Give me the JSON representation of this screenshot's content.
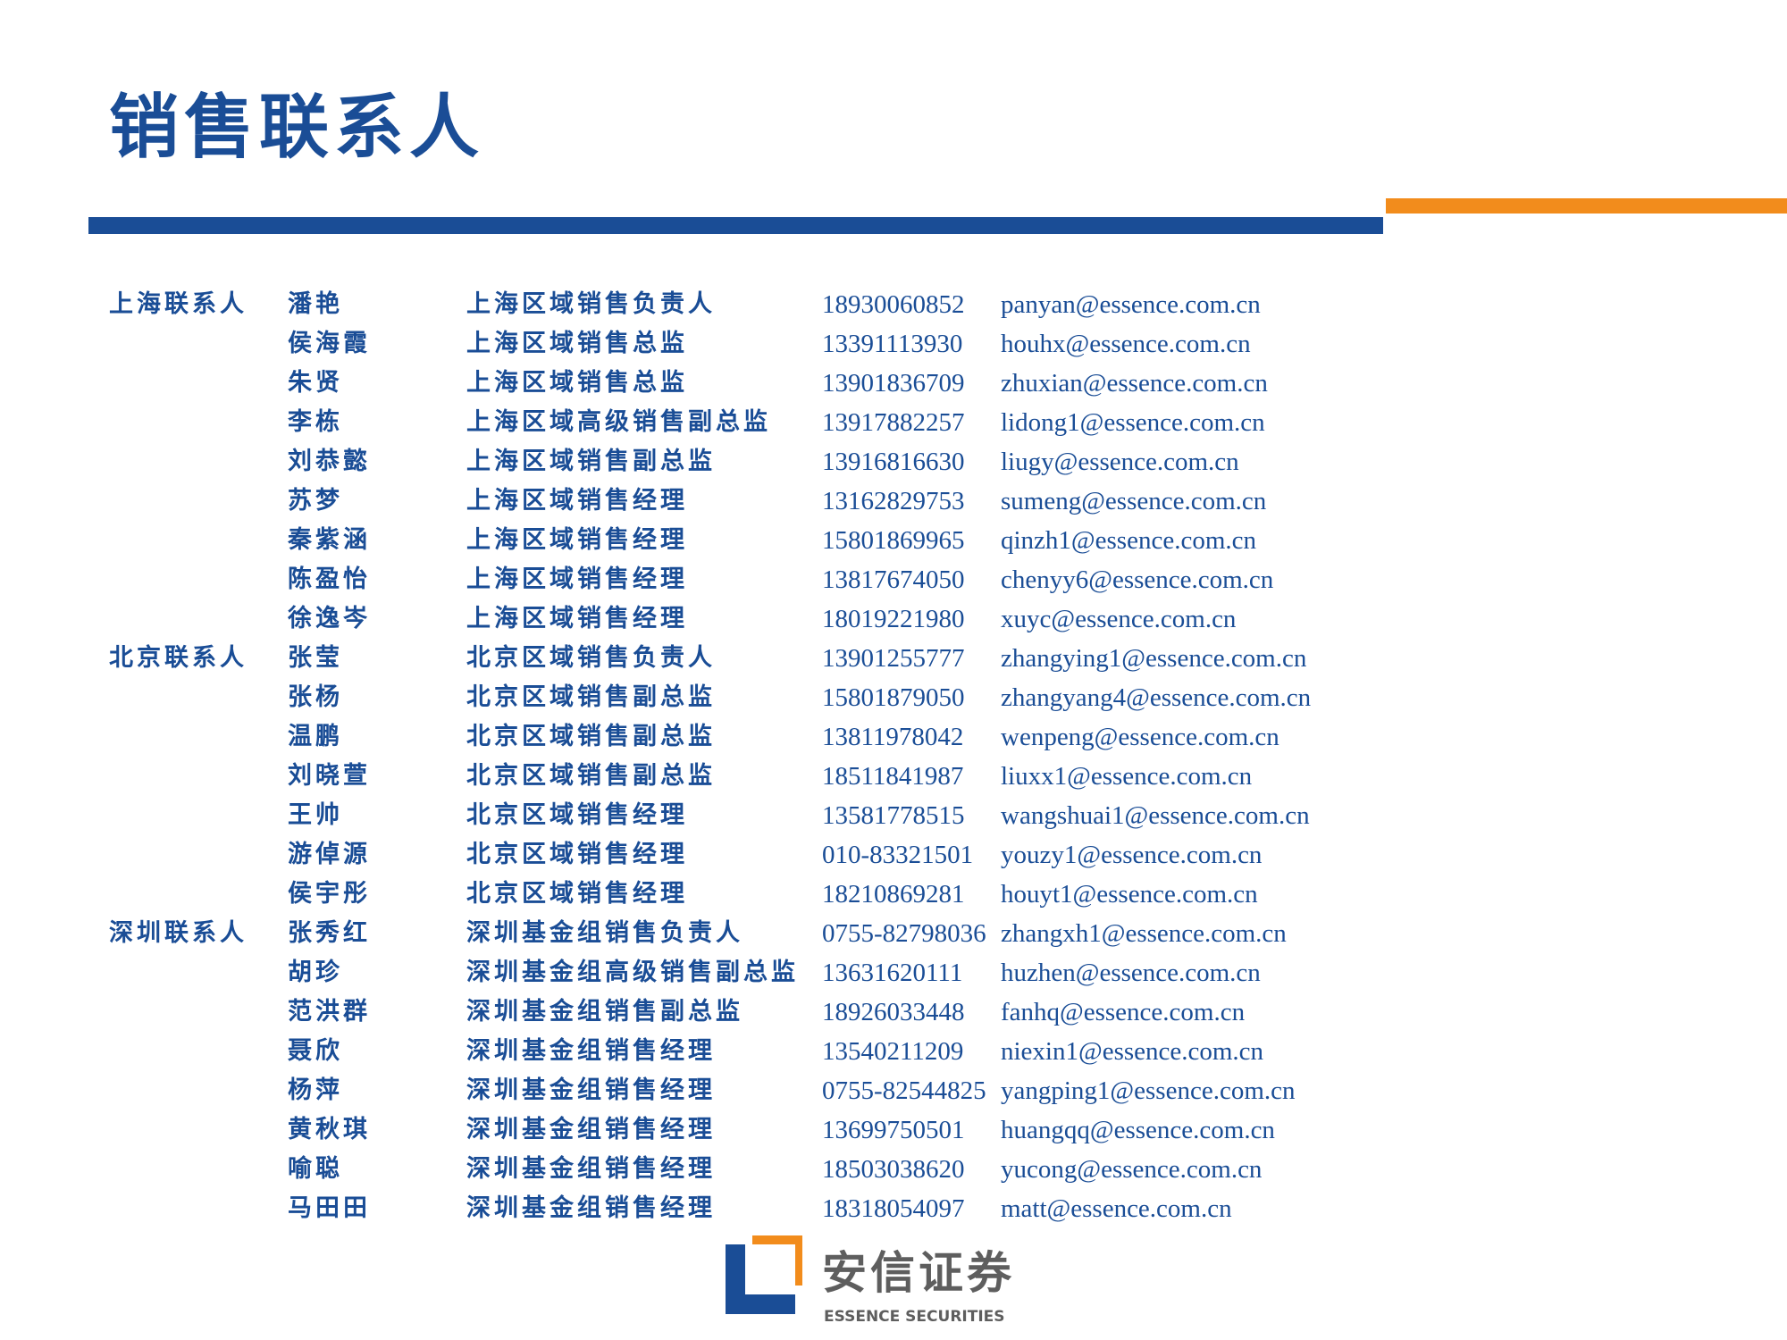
{
  "title": "销售联系人",
  "colors": {
    "primary_blue": "#1a4d96",
    "accent_orange": "#f28c1c",
    "logo_gray": "#5e5e5e"
  },
  "contacts": [
    {
      "city": "上海联系人",
      "name": "潘艳",
      "role": "上海区域销售负责人",
      "phone": "18930060852",
      "email": "panyan@essence.com.cn"
    },
    {
      "city": "",
      "name": "侯海霞",
      "role": "上海区域销售总监",
      "phone": "13391113930",
      "email": "houhx@essence.com.cn"
    },
    {
      "city": "",
      "name": "朱贤",
      "role": "上海区域销售总监",
      "phone": "13901836709",
      "email": "zhuxian@essence.com.cn"
    },
    {
      "city": "",
      "name": "李栋",
      "role": "上海区域高级销售副总监",
      "phone": "13917882257",
      "email": "lidong1@essence.com.cn"
    },
    {
      "city": "",
      "name": "刘恭懿",
      "role": "上海区域销售副总监",
      "phone": "13916816630",
      "email": "liugy@essence.com.cn"
    },
    {
      "city": "",
      "name": "苏梦",
      "role": "上海区域销售经理",
      "phone": "13162829753",
      "email": "sumeng@essence.com.cn"
    },
    {
      "city": "",
      "name": "秦紫涵",
      "role": "上海区域销售经理",
      "phone": "15801869965",
      "email": "qinzh1@essence.com.cn"
    },
    {
      "city": "",
      "name": "陈盈怡",
      "role": "上海区域销售经理",
      "phone": "13817674050",
      "email": "chenyy6@essence.com.cn"
    },
    {
      "city": "",
      "name": "徐逸岑",
      "role": "上海区域销售经理",
      "phone": "18019221980",
      "email": "xuyc@essence.com.cn"
    },
    {
      "city": "北京联系人",
      "name": "张莹",
      "role": "北京区域销售负责人",
      "phone": "13901255777",
      "email": "zhangying1@essence.com.cn"
    },
    {
      "city": "",
      "name": "张杨",
      "role": "北京区域销售副总监",
      "phone": "15801879050",
      "email": "zhangyang4@essence.com.cn"
    },
    {
      "city": "",
      "name": "温鹏",
      "role": "北京区域销售副总监",
      "phone": "13811978042",
      "email": "wenpeng@essence.com.cn"
    },
    {
      "city": "",
      "name": "刘晓萱",
      "role": "北京区域销售副总监",
      "phone": "18511841987",
      "email": "liuxx1@essence.com.cn"
    },
    {
      "city": "",
      "name": "王帅",
      "role": "北京区域销售经理",
      "phone": "13581778515",
      "email": "wangshuai1@essence.com.cn"
    },
    {
      "city": "",
      "name": "游倬源",
      "role": "北京区域销售经理",
      "phone": "010-83321501",
      "email": "youzy1@essence.com.cn"
    },
    {
      "city": "",
      "name": "侯宇彤",
      "role": "北京区域销售经理",
      "phone": "18210869281",
      "email": "houyt1@essence.com.cn"
    },
    {
      "city": "深圳联系人",
      "name": "张秀红",
      "role": "深圳基金组销售负责人",
      "phone": "0755-82798036",
      "email": "zhangxh1@essence.com.cn"
    },
    {
      "city": "",
      "name": "胡珍",
      "role": "深圳基金组高级销售副总监",
      "phone": "13631620111",
      "email": "huzhen@essence.com.cn"
    },
    {
      "city": "",
      "name": "范洪群",
      "role": "深圳基金组销售副总监",
      "phone": "18926033448",
      "email": "fanhq@essence.com.cn"
    },
    {
      "city": "",
      "name": "聂欣",
      "role": "深圳基金组销售经理",
      "phone": "13540211209",
      "email": "niexin1@essence.com.cn"
    },
    {
      "city": "",
      "name": "杨萍",
      "role": "深圳基金组销售经理",
      "phone": "0755-82544825",
      "email": "yangping1@essence.com.cn"
    },
    {
      "city": "",
      "name": "黄秋琪",
      "role": "深圳基金组销售经理",
      "phone": "13699750501",
      "email": "huangqq@essence.com.cn"
    },
    {
      "city": "",
      "name": "喻聪",
      "role": "深圳基金组销售经理",
      "phone": "18503038620",
      "email": "yucong@essence.com.cn"
    },
    {
      "city": "",
      "name": "马田田",
      "role": "深圳基金组销售经理",
      "phone": "18318054097",
      "email": "matt@essence.com.cn"
    }
  ],
  "logo": {
    "cn": "安信证券",
    "en": "ESSENCE SECURITIES",
    "icon": "essence-logo-icon"
  }
}
